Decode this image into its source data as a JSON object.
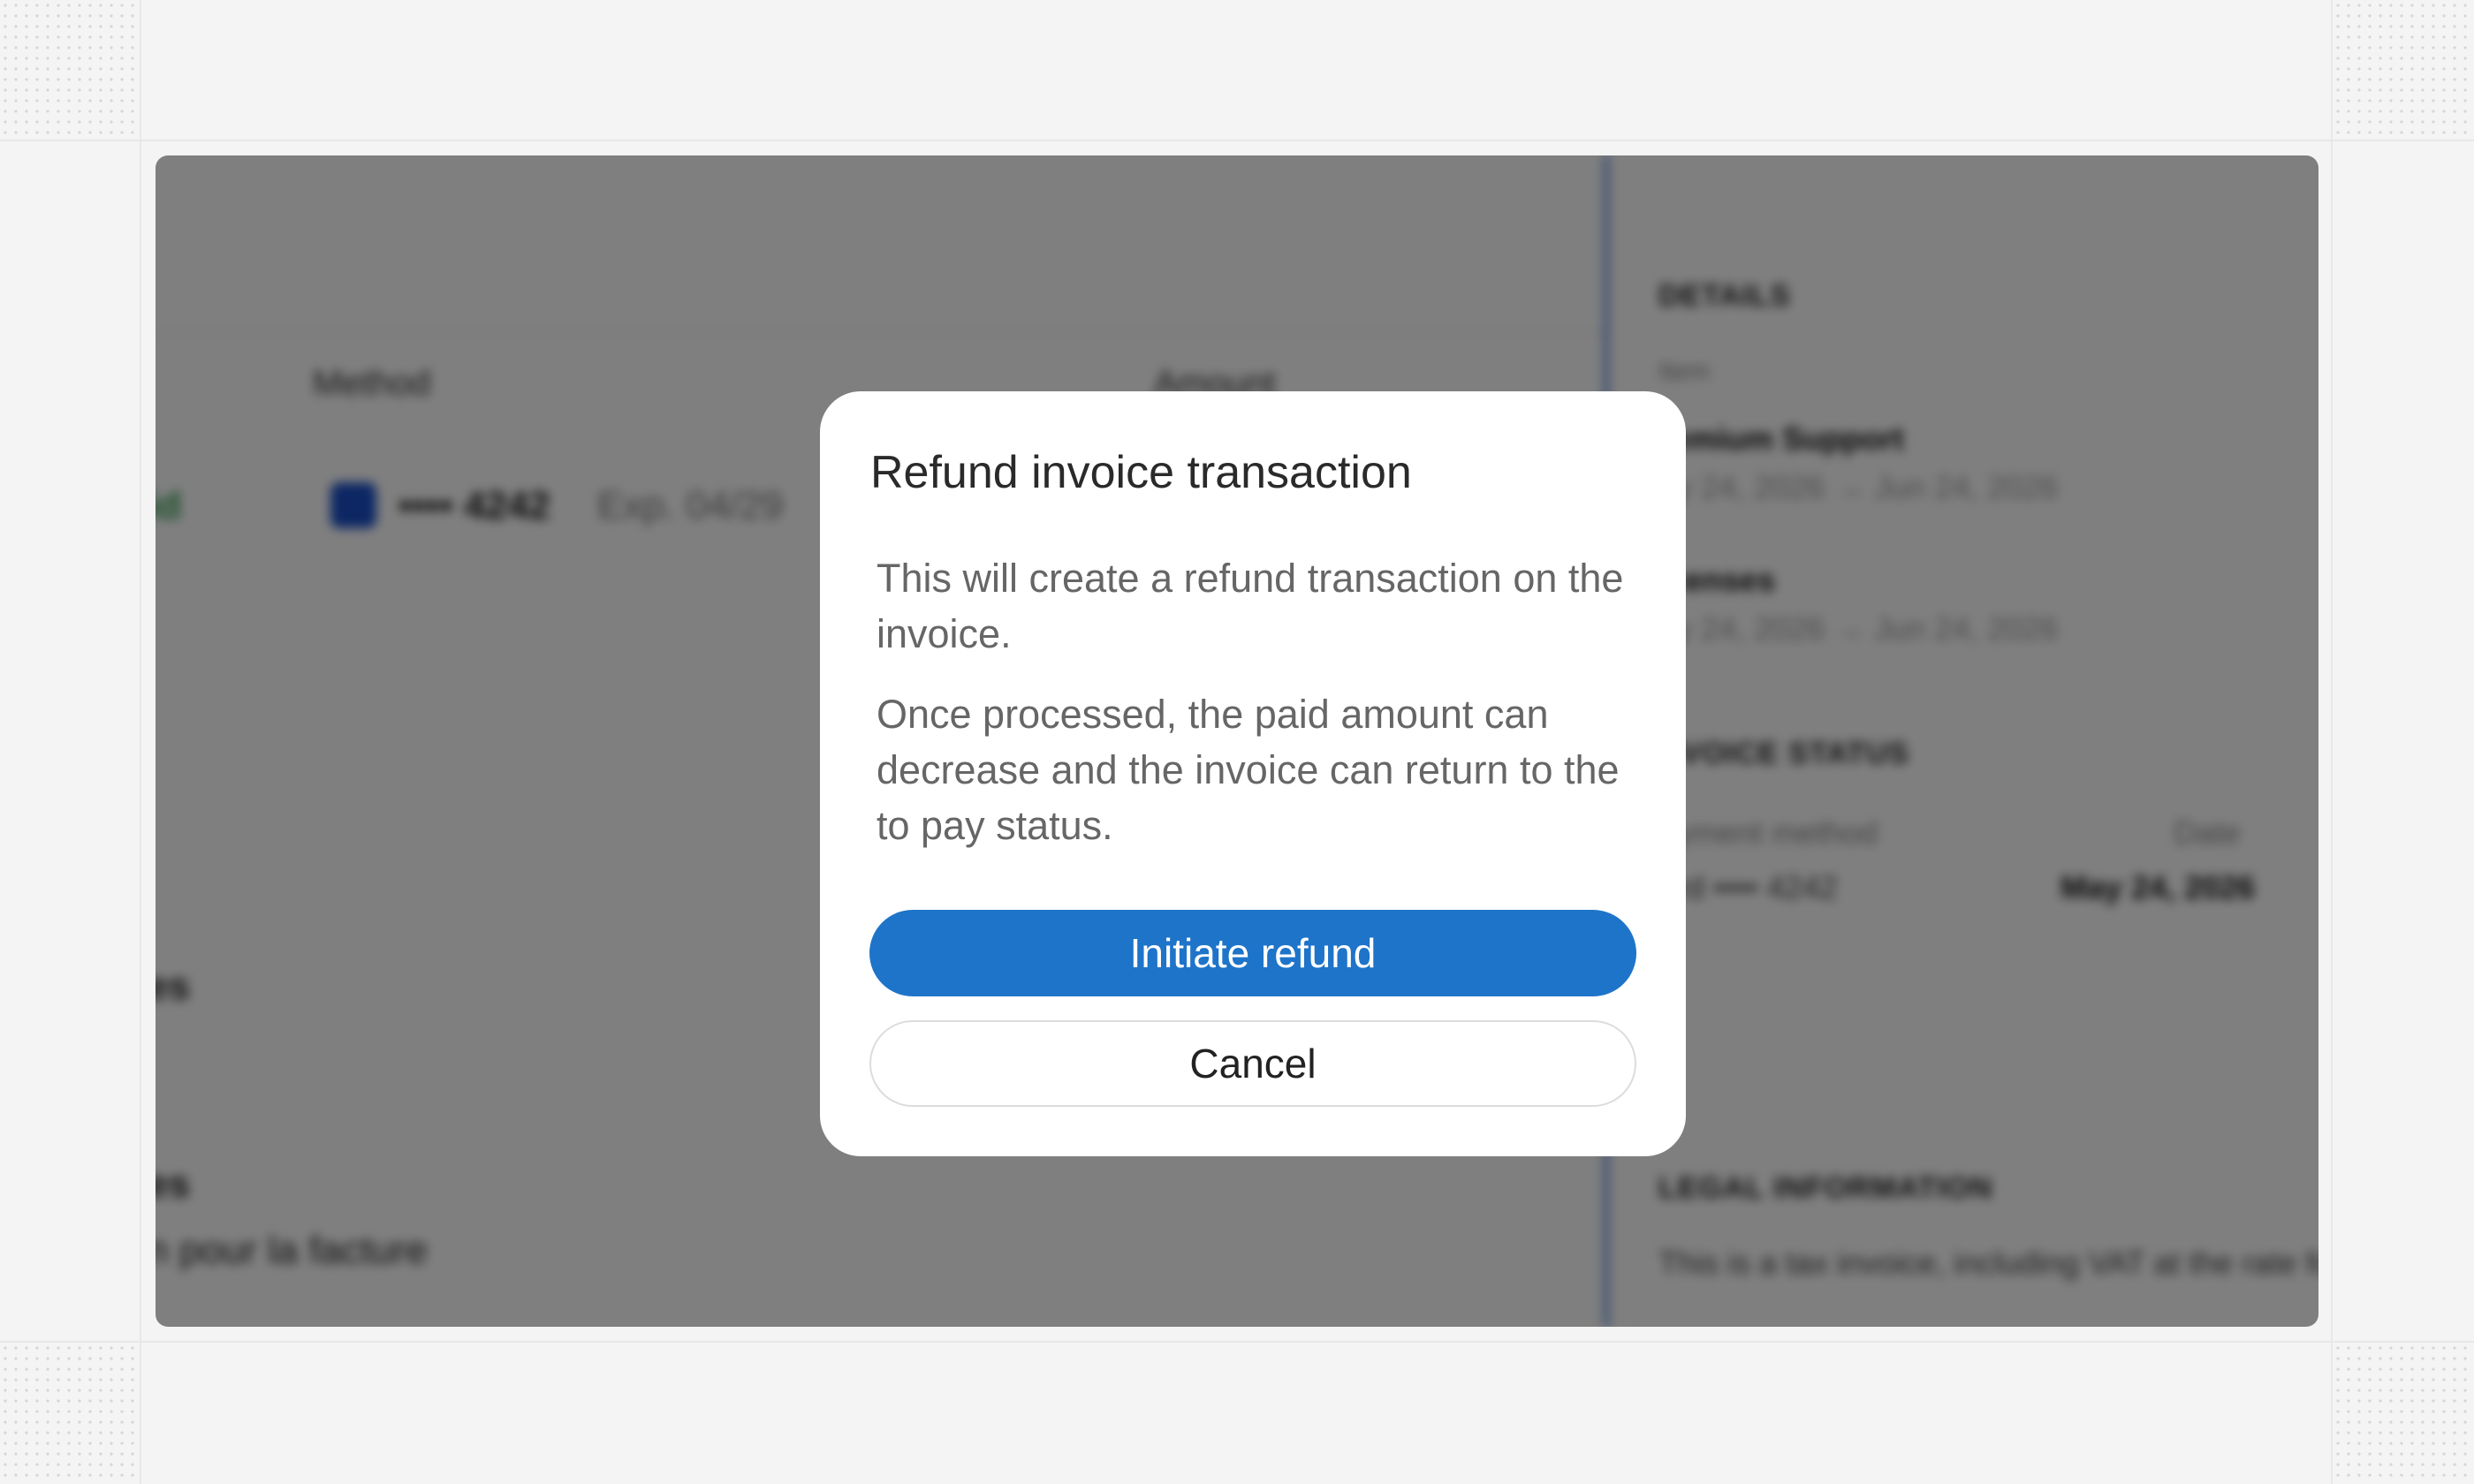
{
  "background": {
    "table": {
      "col_method": "Method",
      "col_amount": "Amount",
      "status_partial": "id",
      "card_masked": "•••• 4242",
      "card_expiry": "Exp. 04/29",
      "section_a": "es",
      "section_b": "es",
      "french_text": "n pour la facture"
    },
    "sidebar": {
      "details_label": "DETAILS",
      "item_label": "Item",
      "item1_name": "remium Support",
      "item1_period": "ay 24, 2026 → Jun 24, 2026",
      "item2_name": "icenses",
      "item2_period": "ay 24, 2026 → Jun 24, 2026",
      "status_label": "NVOICE STATUS",
      "payment_method_label": "ayment method",
      "date_label": "Date",
      "payment_method_value": "ard •••• 4242",
      "date_value": "May 24, 2026",
      "legal_label": "LEGAL INFORMATION",
      "legal_text": "This is a tax invoice, including VAT at the rate fo"
    }
  },
  "modal": {
    "title": "Refund invoice transaction",
    "paragraph1": "This will create a refund transaction on the invoice.",
    "paragraph2": "Once processed, the paid amount can decrease and the invoice can return to the to pay status.",
    "primary_button": "Initiate refund",
    "secondary_button": "Cancel"
  },
  "colors": {
    "primary": "#1e74c9",
    "overlay": "rgba(0,0,0,0.5)",
    "accent_bar": "#1b5fd1"
  }
}
